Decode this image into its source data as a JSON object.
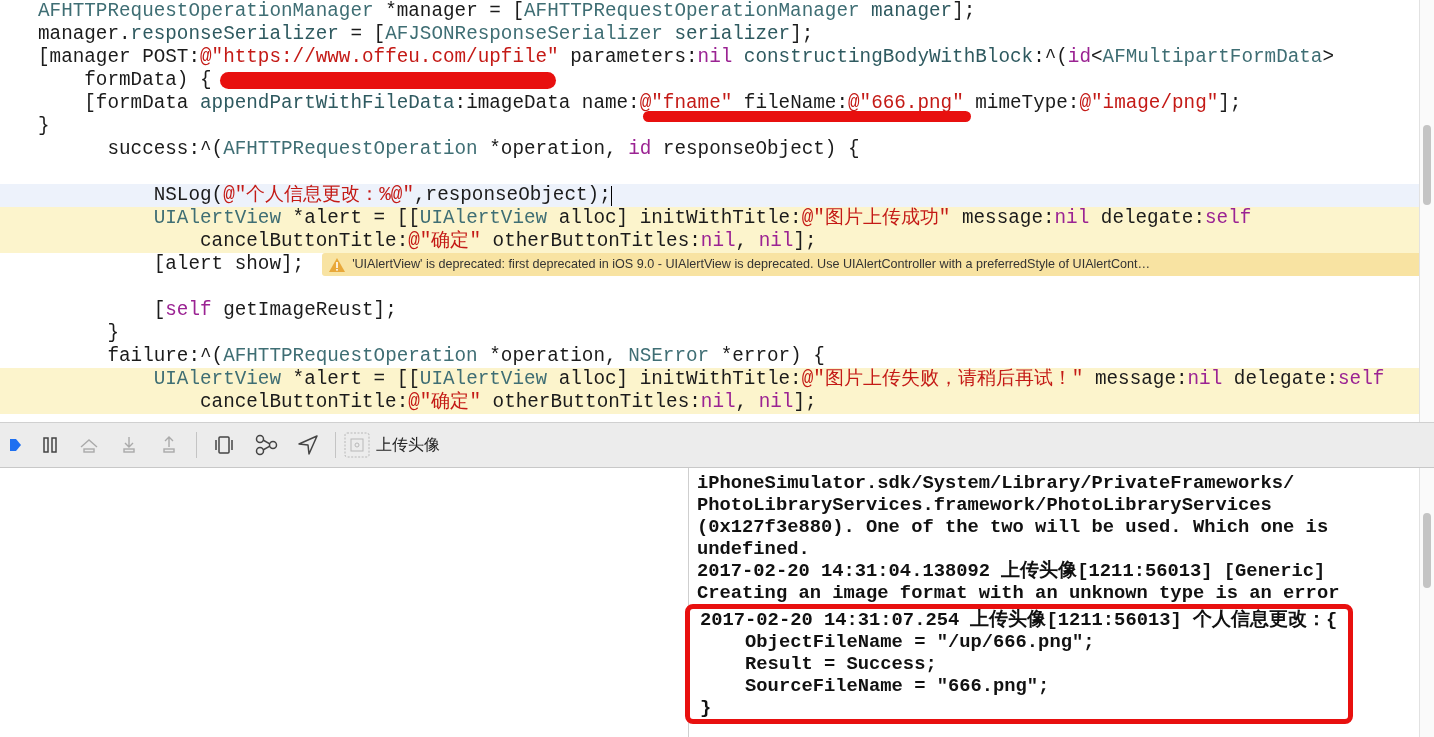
{
  "editor": {
    "code_blocks": [
      [
        {
          "tokens": [
            {
              "kind": "type",
              "text": "AFHTTPRequestOperationManager"
            },
            {
              "kind": "plain",
              "text": " *manager = ["
            },
            {
              "kind": "type",
              "text": "AFHTTPRequestOperationManager"
            },
            {
              "kind": "method",
              "text": " manager"
            },
            {
              "kind": "plain",
              "text": "];"
            }
          ]
        },
        {
          "tokens": [
            {
              "kind": "plain",
              "text": "manager."
            },
            {
              "kind": "method",
              "text": "responseSerializer"
            },
            {
              "kind": "plain",
              "text": " = ["
            },
            {
              "kind": "type",
              "text": "AFJSONResponseSerializer"
            },
            {
              "kind": "method",
              "text": " serializer"
            },
            {
              "kind": "plain",
              "text": "];"
            }
          ]
        },
        {
          "tokens": [
            {
              "kind": "plain",
              "text": "[manager POST:"
            },
            {
              "kind": "string",
              "text": "@\"https://www.offeu.com/upfile\""
            },
            {
              "kind": "plain",
              "text": " parameters:"
            },
            {
              "kind": "keyword",
              "text": "nil"
            },
            {
              "kind": "method",
              "text": " constructingBodyWithBlock"
            },
            {
              "kind": "plain",
              "text": ":^("
            },
            {
              "kind": "keyword",
              "text": "id"
            },
            {
              "kind": "plain",
              "text": "<"
            },
            {
              "kind": "type",
              "text": "AFMultipartFormData"
            },
            {
              "kind": "plain",
              "text": ">"
            }
          ]
        },
        {
          "tokens": [
            {
              "kind": "plain",
              "text": "    formData) {"
            }
          ]
        },
        {
          "tokens": [
            {
              "kind": "plain",
              "text": "    [formData "
            },
            {
              "kind": "method",
              "text": "appendPartWithFileData"
            },
            {
              "kind": "plain",
              "text": ":imageData name:"
            },
            {
              "kind": "string",
              "text": "@\"fname\""
            },
            {
              "kind": "plain",
              "text": " fileName:"
            },
            {
              "kind": "string",
              "text": "@\"666.png\""
            },
            {
              "kind": "plain",
              "text": " mimeType:"
            },
            {
              "kind": "string",
              "text": "@\"image/png\""
            },
            {
              "kind": "plain",
              "text": "];"
            }
          ]
        },
        {
          "tokens": [
            {
              "kind": "plain",
              "text": "}"
            }
          ]
        },
        {
          "tokens": [
            {
              "kind": "plain",
              "text": "      success:^("
            },
            {
              "kind": "type",
              "text": "AFHTTPRequestOperation"
            },
            {
              "kind": "plain",
              "text": " *operation, "
            },
            {
              "kind": "keyword",
              "text": "id"
            },
            {
              "kind": "plain",
              "text": " responseObject) {"
            }
          ]
        }
      ],
      [
        {
          "current": true,
          "tokens": [
            {
              "kind": "plain",
              "text": "          NSLog("
            },
            {
              "kind": "string",
              "text": "@\"个人信息更改：%@\""
            },
            {
              "kind": "plain",
              "text": ",responseObject);"
            }
          ]
        },
        {
          "warning_highlight": true,
          "tokens": [
            {
              "kind": "type",
              "text": "          UIAlertView"
            },
            {
              "kind": "plain",
              "text": " *alert = [["
            },
            {
              "kind": "type",
              "text": "UIAlertView"
            },
            {
              "kind": "plain",
              "text": " alloc] initWithTitle:"
            },
            {
              "kind": "string",
              "text": "@\"图片上传成功\""
            },
            {
              "kind": "plain",
              "text": " message:"
            },
            {
              "kind": "keyword",
              "text": "nil"
            },
            {
              "kind": "plain",
              "text": " delegate:"
            },
            {
              "kind": "keyword",
              "text": "self"
            }
          ]
        },
        {
          "warning_highlight": true,
          "tokens": [
            {
              "kind": "plain",
              "text": "              cancelButtonTitle:"
            },
            {
              "kind": "string",
              "text": "@\"确定\""
            },
            {
              "kind": "plain",
              "text": " otherButtonTitles:"
            },
            {
              "kind": "keyword",
              "text": "nil"
            },
            {
              "kind": "plain",
              "text": ", "
            },
            {
              "kind": "keyword",
              "text": "nil"
            },
            {
              "kind": "plain",
              "text": "];"
            }
          ]
        },
        {
          "warning_message": "'UIAlertView' is deprecated: first deprecated in iOS 9.0 - UIAlertView is deprecated. Use UIAlertController with a preferredStyle of UIAlertCont…",
          "tokens": [
            {
              "kind": "plain",
              "text": "          [alert show];"
            }
          ]
        }
      ],
      [
        {
          "tokens": [
            {
              "kind": "plain",
              "text": "          ["
            },
            {
              "kind": "keyword",
              "text": "self"
            },
            {
              "kind": "plain",
              "text": " getImageReust];"
            }
          ]
        },
        {
          "tokens": [
            {
              "kind": "plain",
              "text": "      }"
            }
          ]
        },
        {
          "tokens": [
            {
              "kind": "plain",
              "text": "      failure:^("
            },
            {
              "kind": "type",
              "text": "AFHTTPRequestOperation"
            },
            {
              "kind": "plain",
              "text": " *operation, "
            },
            {
              "kind": "type",
              "text": "NSError"
            },
            {
              "kind": "plain",
              "text": " *error) {"
            }
          ]
        },
        {
          "warning_highlight": true,
          "tokens": [
            {
              "kind": "type",
              "text": "          UIAlertView"
            },
            {
              "kind": "plain",
              "text": " *alert = [["
            },
            {
              "kind": "type",
              "text": "UIAlertView"
            },
            {
              "kind": "plain",
              "text": " alloc] initWithTitle:"
            },
            {
              "kind": "string",
              "text": "@\"图片上传失败，请稍后再试！\""
            },
            {
              "kind": "plain",
              "text": " message:"
            },
            {
              "kind": "keyword",
              "text": "nil"
            },
            {
              "kind": "plain",
              "text": " delegate:"
            },
            {
              "kind": "keyword",
              "text": "self"
            }
          ]
        },
        {
          "warning_highlight": true,
          "tokens": [
            {
              "kind": "plain",
              "text": "              cancelButtonTitle:"
            },
            {
              "kind": "string",
              "text": "@\"确定\""
            },
            {
              "kind": "plain",
              "text": " otherButtonTitles:"
            },
            {
              "kind": "keyword",
              "text": "nil"
            },
            {
              "kind": "plain",
              "text": ", "
            },
            {
              "kind": "keyword",
              "text": "nil"
            },
            {
              "kind": "plain",
              "text": "];"
            }
          ]
        }
      ]
    ]
  },
  "debug_bar": {
    "buttons": [
      {
        "kind": "continue",
        "disabled": false
      },
      {
        "kind": "pause",
        "disabled": false
      },
      {
        "kind": "step_over",
        "disabled": true
      },
      {
        "kind": "step_into",
        "disabled": true
      },
      {
        "kind": "step_out",
        "disabled": true
      },
      {
        "kind": "view_debugger",
        "disabled": false
      },
      {
        "kind": "memory_graph",
        "disabled": false
      },
      {
        "kind": "location",
        "disabled": false
      }
    ],
    "process": "上传头像"
  },
  "console": {
    "lines": [
      "iPhoneSimulator.sdk/System/Library/PrivateFrameworks/",
      "PhotoLibraryServices.framework/PhotoLibraryServices",
      "(0x127f3e880). One of the two will be used. Which one is",
      "undefined.",
      "2017-02-20 14:31:04.138092 上传头像[1211:56013] [Generic]",
      "Creating an image format with an unknown type is an error"
    ],
    "framed_lines": [
      "2017-02-20 14:31:07.254 上传头像[1211:56013] 个人信息更改：{",
      "    ObjectFileName = \"/up/666.png\";",
      "    Result = Success;",
      "    SourceFileName = \"666.png\";",
      "}"
    ]
  }
}
